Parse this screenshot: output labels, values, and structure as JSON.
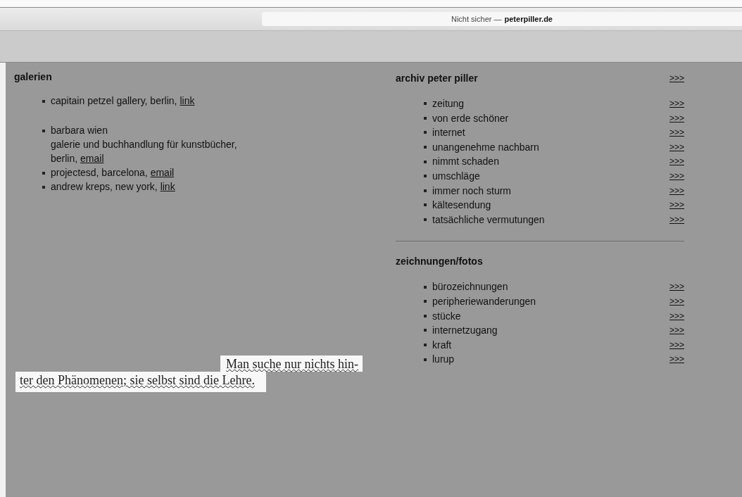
{
  "browser": {
    "address_prefix": "Nicht sicher —",
    "address_domain": "peterpiller.de"
  },
  "galerien": {
    "title": "galerien",
    "groups": [
      [
        {
          "text": "capitain petzel gallery, berlin, ",
          "link": "link"
        }
      ],
      [
        {
          "lines": [
            "barbara wien",
            "galerie und buchhandlung für kunstbücher,"
          ],
          "text": "berlin, ",
          "link": "email"
        },
        {
          "text": "projectesd, barcelona, ",
          "link": "email"
        },
        {
          "text": "andrew kreps, new york, ",
          "link": "link"
        }
      ]
    ]
  },
  "quote": {
    "line_1": "Man suche nur nichts hin-",
    "line_2": "ter den Phänomenen; sie selbst sind die Lehre."
  },
  "sections": [
    {
      "title": "archiv peter piller",
      "more": ">>>",
      "items": [
        {
          "label": "zeitung",
          "more": ">>>"
        },
        {
          "label": "von erde schöner",
          "more": ">>>"
        },
        {
          "label": "internet",
          "more": ">>>"
        },
        {
          "label": "unangenehme nachbarn",
          "more": ">>>"
        },
        {
          "label": "nimmt schaden",
          "more": ">>>"
        },
        {
          "label": "umschläge",
          "more": ">>>"
        },
        {
          "label": "immer noch sturm",
          "more": ">>>"
        },
        {
          "label": "kältesendung",
          "more": ">>>"
        },
        {
          "label": "tatsächliche vermutungen",
          "more": ">>>"
        }
      ]
    },
    {
      "title": "zeichnungen/fotos",
      "items": [
        {
          "label": "bürozeichnungen",
          "more": ">>>"
        },
        {
          "label": "peripheriewanderungen",
          "more": ">>>"
        },
        {
          "label": "stücke",
          "more": ">>>"
        },
        {
          "label": "internetzugang",
          "more": ">>>"
        },
        {
          "label": "kraft",
          "more": ">>>"
        },
        {
          "label": "lurup",
          "more": ">>>"
        }
      ]
    }
  ]
}
